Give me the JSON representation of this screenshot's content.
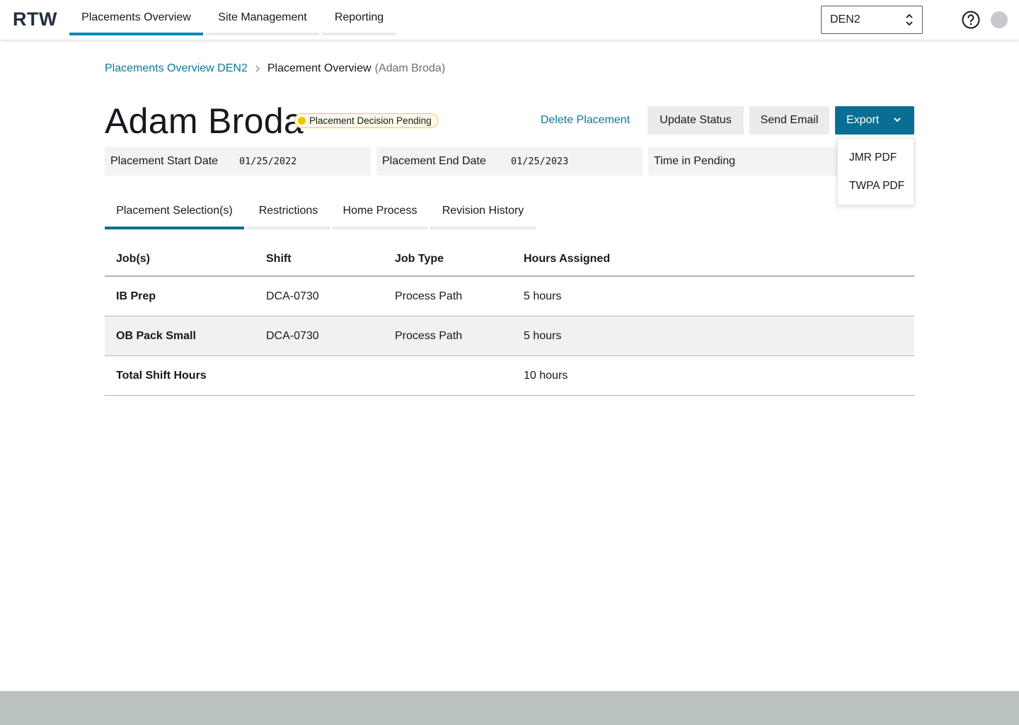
{
  "app": {
    "logo": "RTW"
  },
  "nav": {
    "tabs": [
      {
        "label": "Placements Overview",
        "active": true
      },
      {
        "label": "Site Management",
        "active": false
      },
      {
        "label": "Reporting",
        "active": false
      }
    ],
    "site_select": {
      "value": "DEN2"
    }
  },
  "breadcrumb": {
    "link": "Placements Overview DEN2",
    "current": "Placement Overview",
    "sub": "(Adam Broda)"
  },
  "header": {
    "title": "Adam Broda",
    "status": "Placement Decision Pending",
    "delete_label": "Delete Placement",
    "update_label": "Update Status",
    "email_label": "Send Email",
    "export_label": "Export"
  },
  "export_menu": {
    "items": [
      "JMR PDF",
      "TWPA PDF"
    ]
  },
  "fields": {
    "start_label": "Placement Start Date",
    "start_value": "01/25/2022",
    "end_label": "Placement End Date",
    "end_value": "01/25/2023",
    "pending_label": "Time in Pending"
  },
  "sub_tabs": [
    {
      "label": "Placement Selection(s)",
      "active": true
    },
    {
      "label": "Restrictions",
      "active": false
    },
    {
      "label": "Home Process",
      "active": false
    },
    {
      "label": "Revision History",
      "active": false
    }
  ],
  "table": {
    "columns": [
      "Job(s)",
      "Shift",
      "Job Type",
      "Hours Assigned"
    ],
    "rows": [
      {
        "job": "IB Prep",
        "shift": "DCA-0730",
        "type": "Process Path",
        "hours": "5 hours"
      },
      {
        "job": "OB Pack Small",
        "shift": "DCA-0730",
        "type": "Process Path",
        "hours": "5 hours"
      }
    ],
    "total": {
      "label": "Total Shift Hours",
      "hours": "10 hours"
    }
  },
  "colors": {
    "accent": "#0a6e93",
    "link": "#0a7a9a",
    "status": "#f2c200"
  }
}
